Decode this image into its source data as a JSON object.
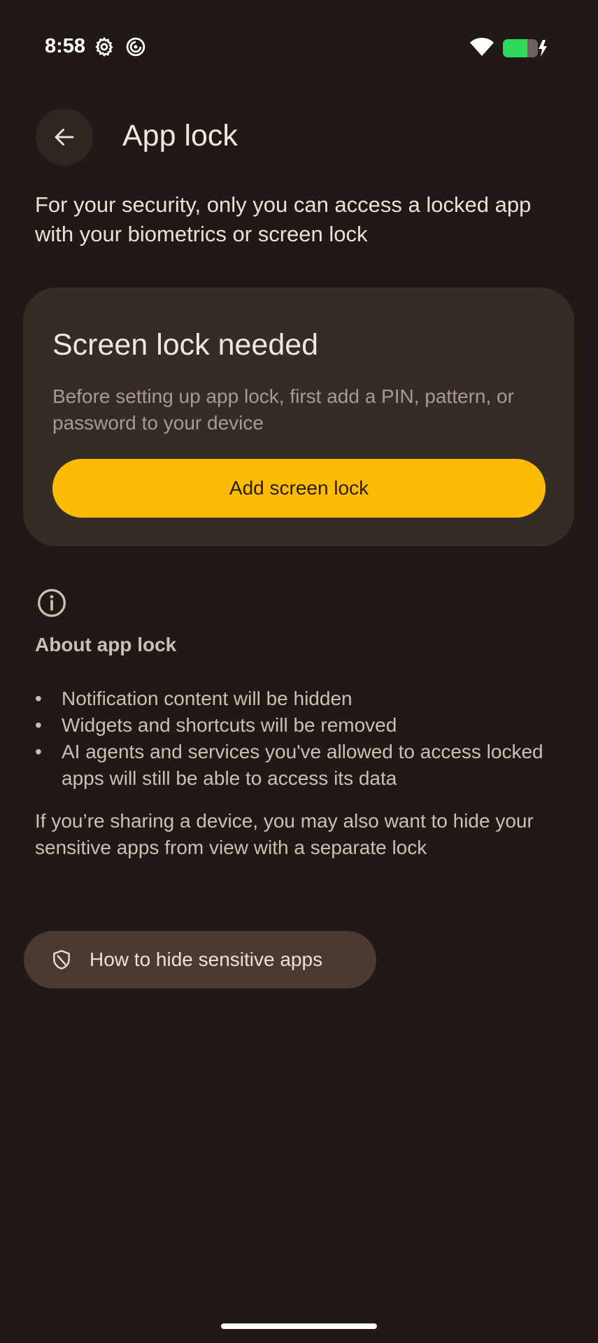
{
  "status_bar": {
    "time": "8:58",
    "icons": [
      "gear-icon",
      "sync-icon",
      "wifi-icon",
      "battery-charging-icon"
    ],
    "battery_color": "#2fd85a"
  },
  "header": {
    "back_icon": "arrow-back-icon",
    "title": "App lock"
  },
  "intro": "For your security, only you can access a locked app with your biometrics or screen lock",
  "card": {
    "title": "Screen lock needed",
    "description": "Before setting up app lock, first add a PIN, pattern, or password to your device",
    "button_label": "Add screen lock",
    "button_color": "#fcbc06"
  },
  "about": {
    "icon": "info-icon",
    "title": "About app lock",
    "bullets": [
      "Notification content will be hidden",
      "Widgets and shortcuts will be removed",
      "AI agents and services you've allowed to access locked apps will still be able to access its data"
    ],
    "note": "If you’re sharing a device, you may also want to hide your sensitive apps from view with a separate lock"
  },
  "hide_apps": {
    "icon": "shield-icon",
    "label": "How to hide sensitive apps"
  }
}
